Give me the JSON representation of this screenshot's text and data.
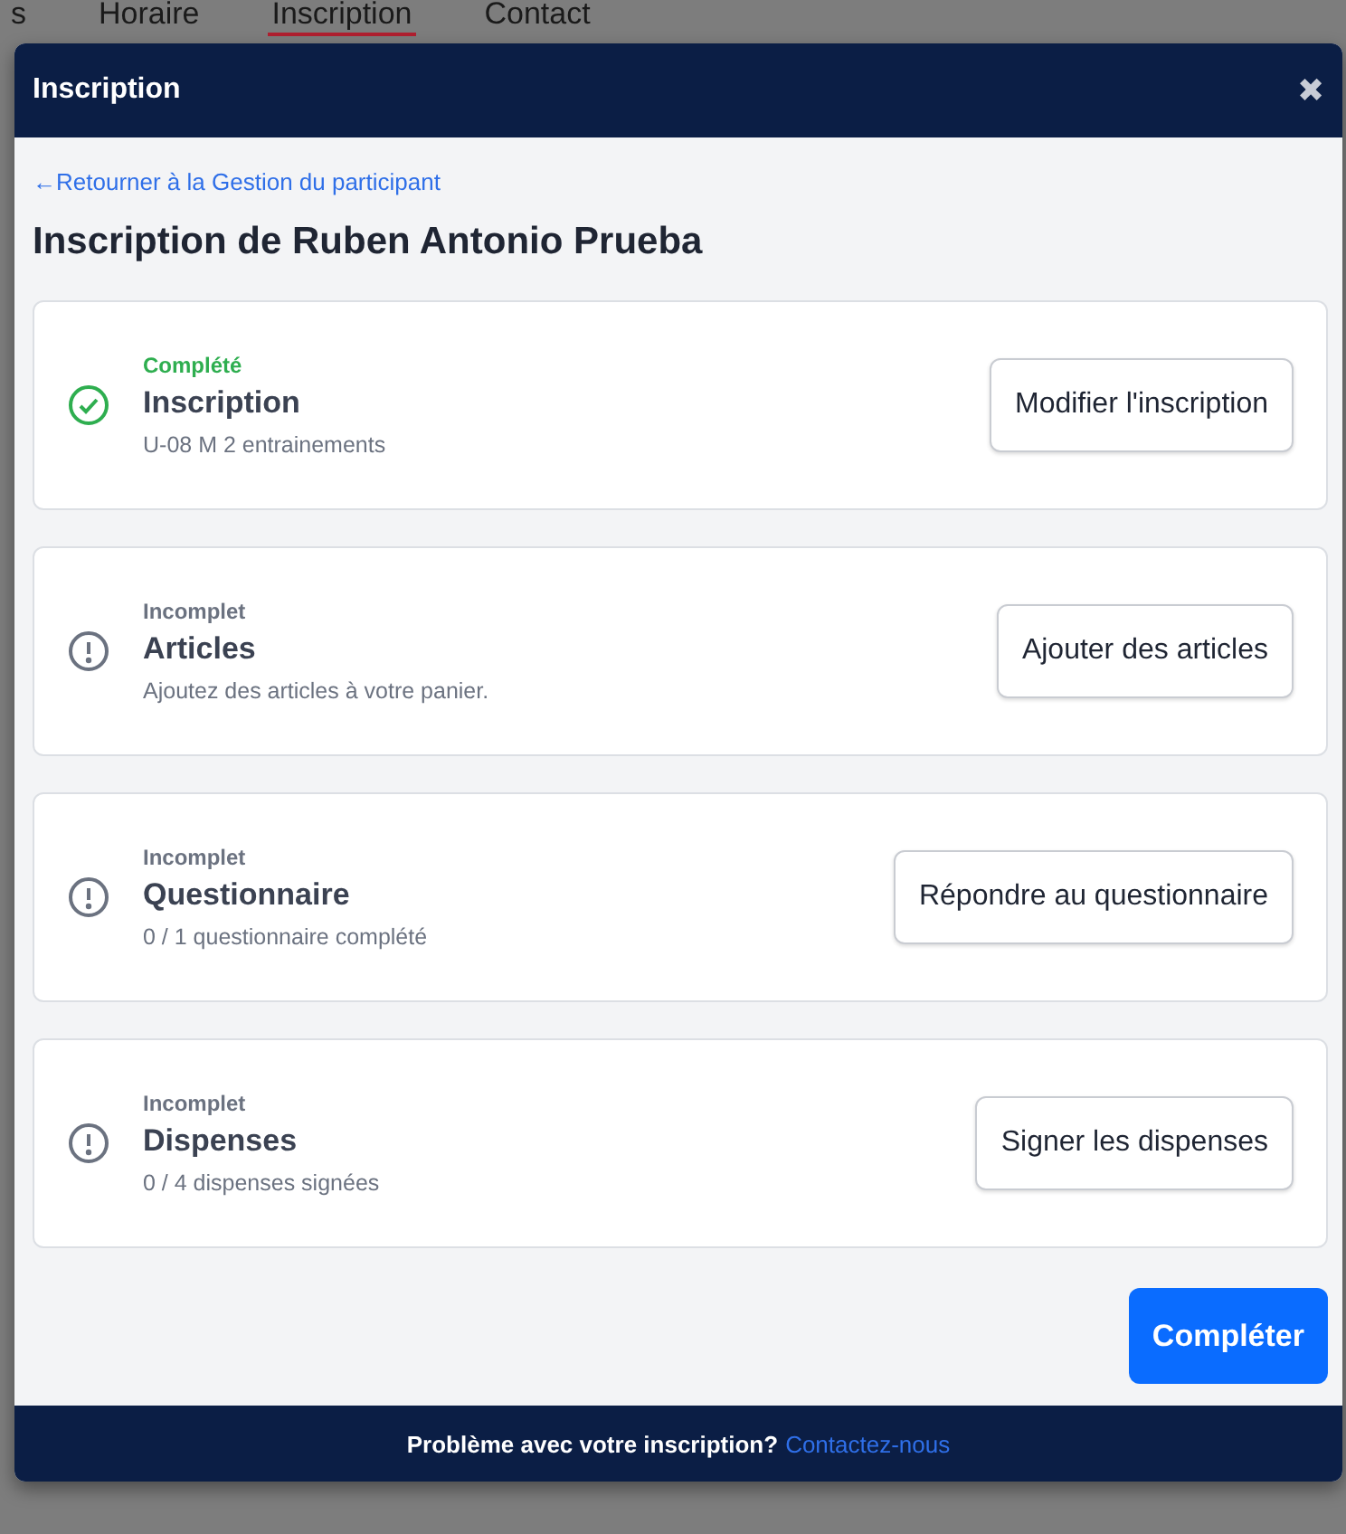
{
  "background_tabs": [
    {
      "label": "s",
      "selected": false
    },
    {
      "label": "Horaire",
      "selected": false
    },
    {
      "label": "Inscription",
      "selected": true
    },
    {
      "label": "Contact",
      "selected": false
    }
  ],
  "dialog": {
    "title": "Inscription",
    "close": "✖",
    "back_link": "←Retourner à la Gestion du participant",
    "heading": "Inscription de Ruben Antonio Prueba",
    "steps": [
      {
        "kind": "complete",
        "status": "Complété",
        "title": "Inscription",
        "detail": "U-08 M 2 entrainements",
        "action": "Modifier l'inscription"
      },
      {
        "kind": "incomplete",
        "status": "Incomplet",
        "title": "Articles",
        "detail": "Ajoutez des articles à votre panier.",
        "action": "Ajouter des articles"
      },
      {
        "kind": "incomplete",
        "status": "Incomplet",
        "title": "Questionnaire",
        "detail": "0 / 1 questionnaire complété",
        "action": "Répondre au questionnaire"
      },
      {
        "kind": "incomplete",
        "status": "Incomplet",
        "title": "Dispenses",
        "detail": "0 / 4 dispenses signées",
        "action": "Signer les dispenses"
      }
    ],
    "submit": "Compléter",
    "footer": {
      "text": "Problème avec votre inscription?",
      "link": "Contactez-nous"
    }
  }
}
